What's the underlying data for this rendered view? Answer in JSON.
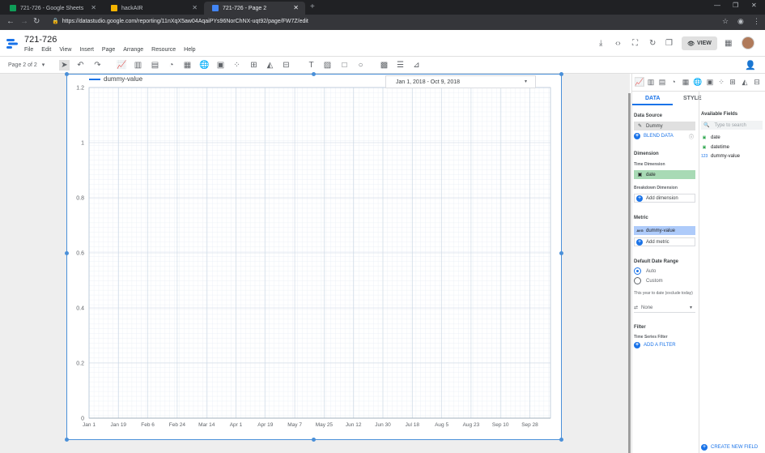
{
  "browser": {
    "tabs": [
      {
        "label": "721-726 - Google Sheets",
        "favcolor": "#0f9d58",
        "active": false
      },
      {
        "label": "hackAIR",
        "favcolor": "#f4b400",
        "active": false
      },
      {
        "label": "721-726 - Page 2",
        "favcolor": "#4285f4",
        "active": true
      }
    ],
    "new_tab": "+",
    "url": "https://datastudio.google.com/reporting/11nXqX5aw04AqaiPYs96NorChNX-uqt92/page/FW7Z/edit"
  },
  "app": {
    "title": "721-726",
    "menu": [
      "File",
      "Edit",
      "View",
      "Insert",
      "Page",
      "Arrange",
      "Resource",
      "Help"
    ],
    "view_button": "VIEW"
  },
  "toolbar": {
    "page_selector": "Page 2 of 2"
  },
  "chart": {
    "legend": "dummy-value",
    "date_range": "Jan 1, 2018 - Oct 9, 2018"
  },
  "chart_data": {
    "type": "line",
    "series": [
      {
        "name": "dummy-value",
        "values": []
      }
    ],
    "x_ticks": [
      "Jan 1",
      "Jan 19",
      "Feb 6",
      "Feb 24",
      "Mar 14",
      "Apr 1",
      "Apr 19",
      "May 7",
      "May 25",
      "Jun 12",
      "Jun 30",
      "Jul 18",
      "Aug 5",
      "Aug 23",
      "Sep 10",
      "Sep 28"
    ],
    "y_ticks": [
      "0",
      "0.2",
      "0.4",
      "0.6",
      "0.8",
      "1",
      "1.2"
    ],
    "ylim": [
      0,
      1.2
    ],
    "grid": true,
    "legend_position": "top-left",
    "line_color": "#1a73e8"
  },
  "panel": {
    "tabs": {
      "data": "DATA",
      "style": "STYLE"
    },
    "data_source_label": "Data Source",
    "data_source": "Dummy",
    "blend_data": "BLEND DATA",
    "dimension_label": "Dimension",
    "time_dimension_label": "Time Dimension",
    "time_dimension": "date",
    "breakdown_label": "Breakdown Dimension",
    "add_dimension": "Add dimension",
    "metric_label": "Metric",
    "metric_agg": "AVG",
    "metric": "dummy-value",
    "add_metric": "Add metric",
    "date_range_label": "Default Date Range",
    "auto": "Auto",
    "custom": "Custom",
    "date_note": "This year to date (exclude today)",
    "comparison": "None",
    "filter_label": "Filter",
    "ts_filter_label": "Time Series Filter",
    "add_filter": "ADD A FILTER",
    "available_label": "Available Fields",
    "search_placeholder": "Type to search",
    "fields": [
      {
        "name": "date",
        "type": "date"
      },
      {
        "name": "datetime",
        "type": "date"
      },
      {
        "name": "dummy-value",
        "type": "123"
      }
    ],
    "create_field": "CREATE NEW FIELD"
  }
}
